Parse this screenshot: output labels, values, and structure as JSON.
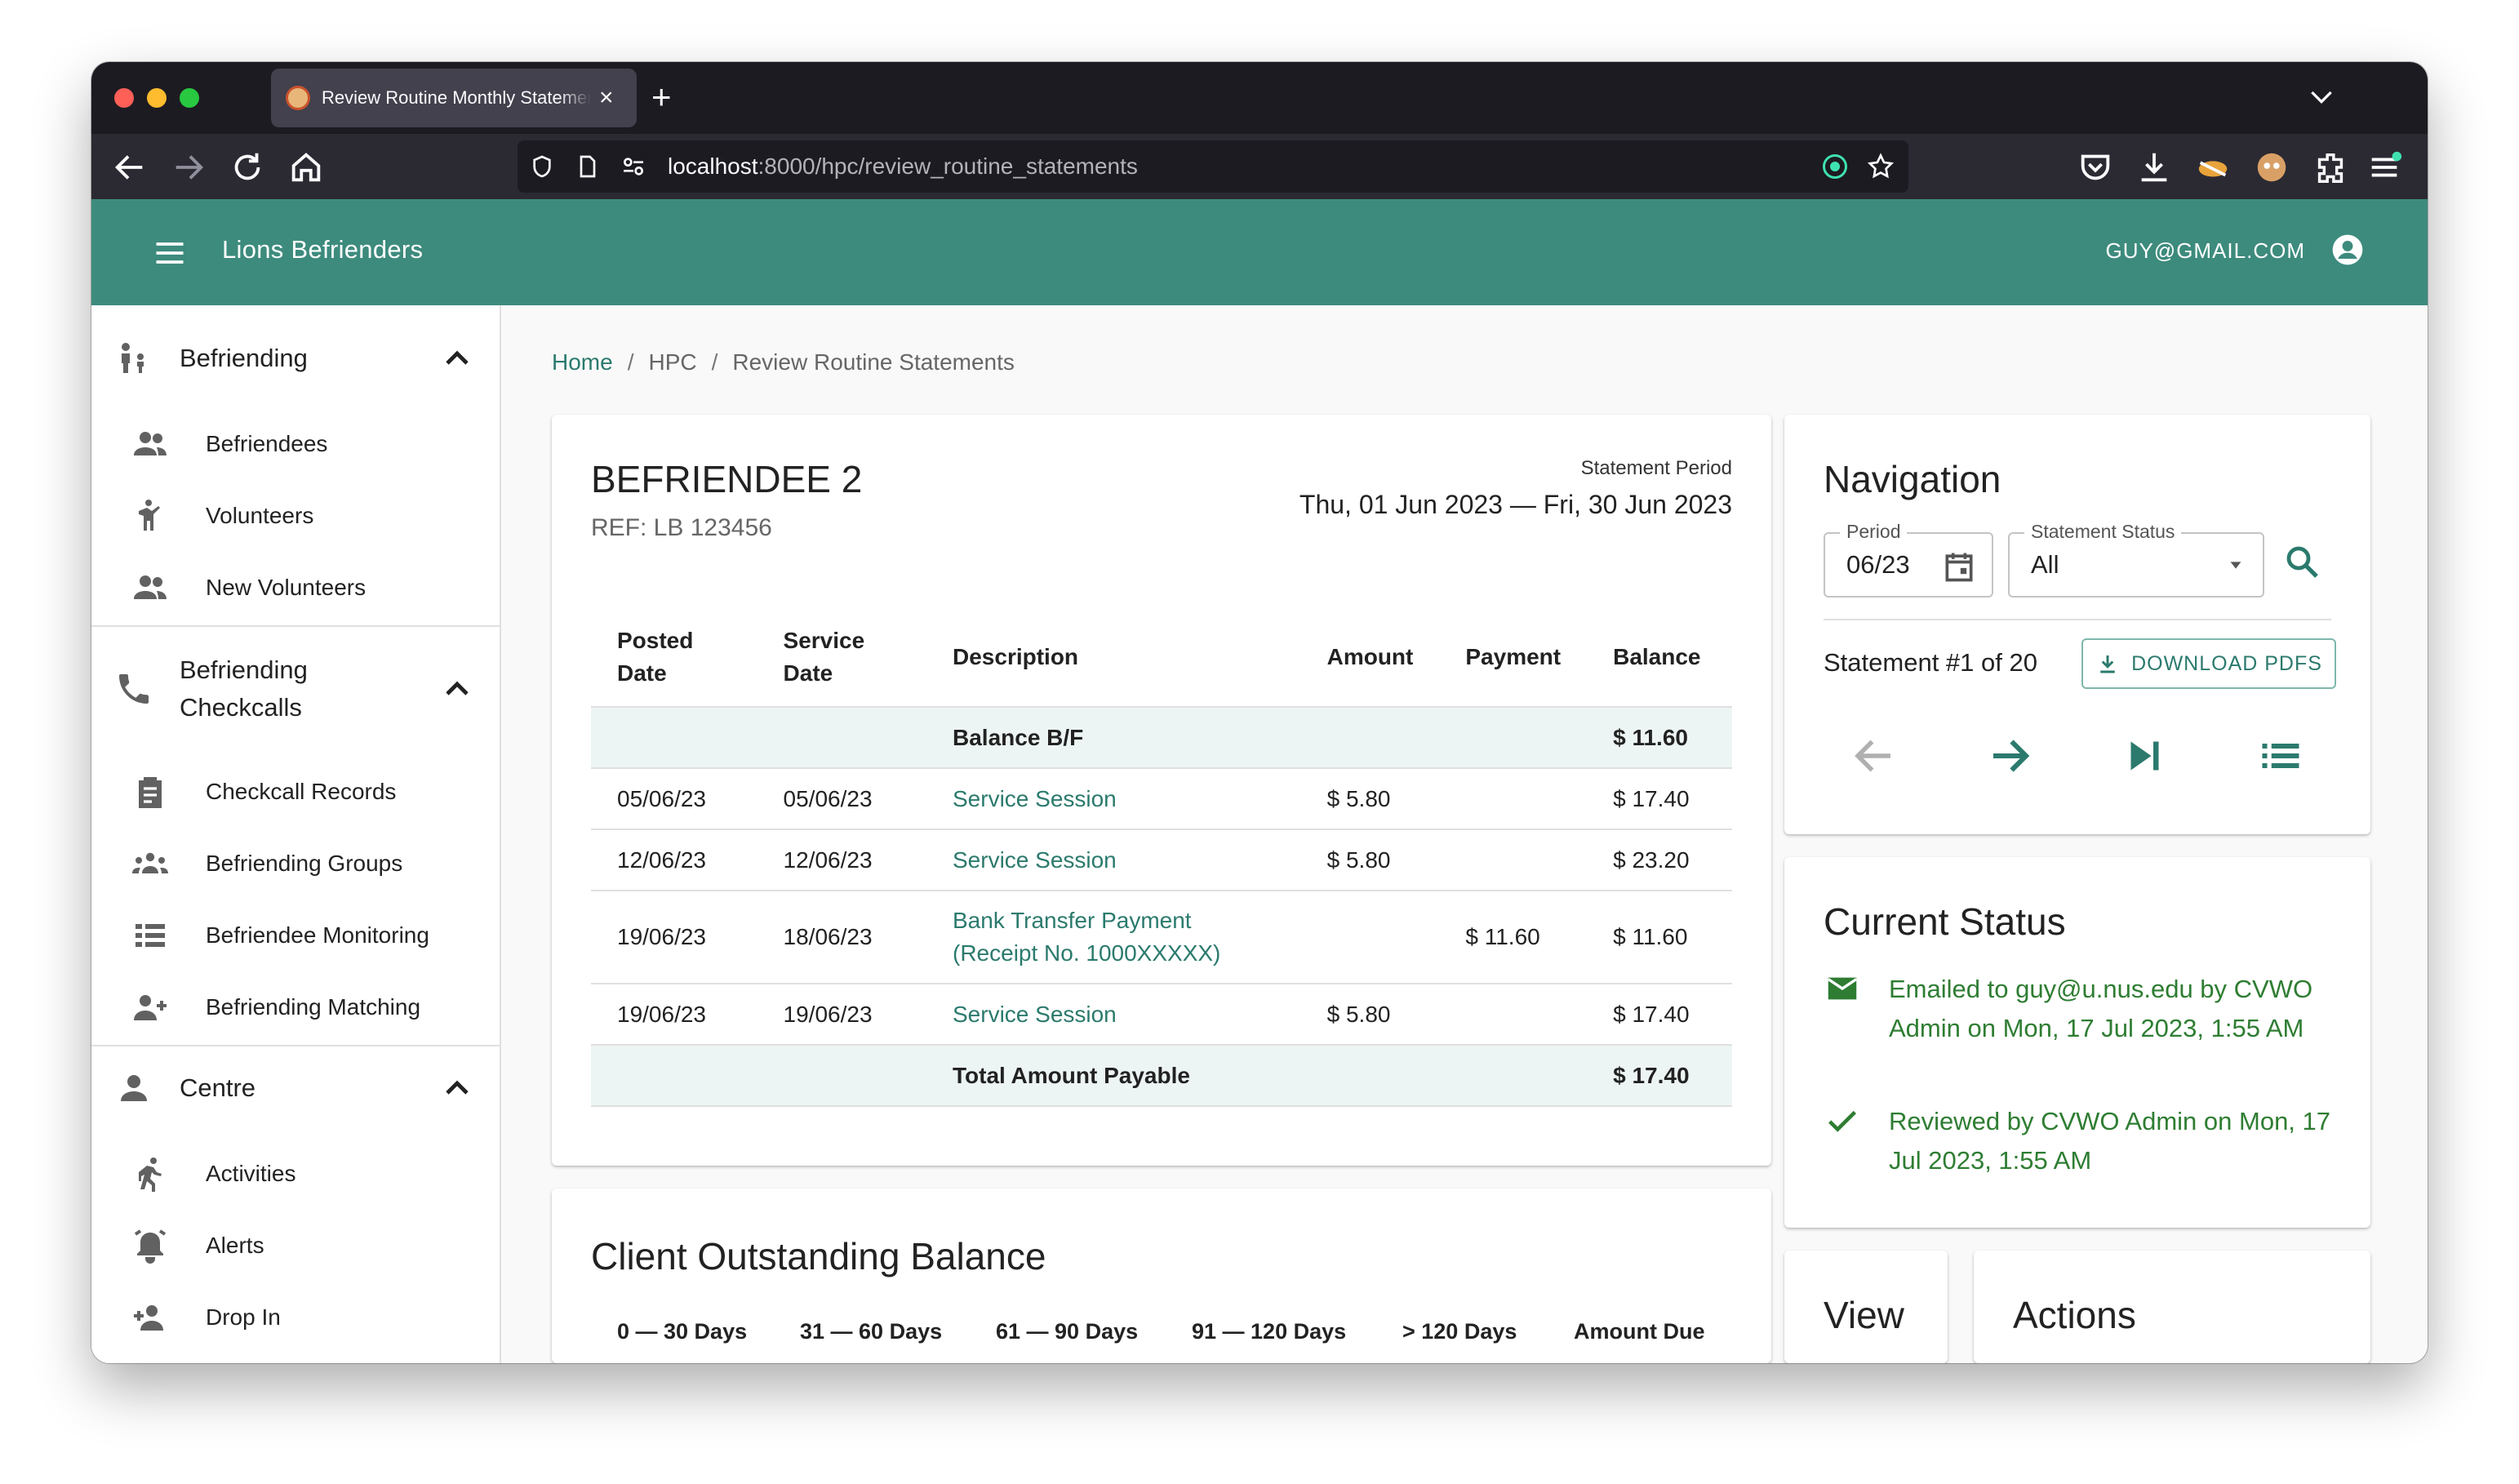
{
  "browser": {
    "tab_title": "Review Routine Monthly Statements",
    "url_host": "localhost",
    "url_path": ":8000/hpc/review_routine_statements"
  },
  "appbar": {
    "title": "Lions Befrienders",
    "user_email": "GUY@GMAIL.COM"
  },
  "sidebar": {
    "groups": [
      {
        "label": "Befriending",
        "icon": "family-icon",
        "items": [
          {
            "label": "Befriendees",
            "icon": "people-icon"
          },
          {
            "label": "Volunteers",
            "icon": "volunteer-icon"
          },
          {
            "label": "New Volunteers",
            "icon": "people-icon"
          }
        ]
      },
      {
        "label": "Befriending Checkcalls",
        "icon": "phone-icon",
        "items": [
          {
            "label": "Checkcall Records",
            "icon": "clipboard-icon"
          },
          {
            "label": "Befriending Groups",
            "icon": "groups-icon"
          },
          {
            "label": "Befriendee Monitoring",
            "icon": "list-icon"
          },
          {
            "label": "Befriending Matching",
            "icon": "person-add-icon"
          }
        ]
      },
      {
        "label": "Centre",
        "icon": "person-icon",
        "items": [
          {
            "label": "Activities",
            "icon": "run-icon"
          },
          {
            "label": "Alerts",
            "icon": "alarm-icon"
          },
          {
            "label": "Drop In",
            "icon": "person-add-icon"
          }
        ]
      }
    ]
  },
  "breadcrumb": {
    "home": "Home",
    "sep": "/",
    "hpc": "HPC",
    "current": "Review Routine Statements"
  },
  "statement": {
    "name": "BEFRIENDEE 2",
    "ref": "REF: LB 123456",
    "period_label": "Statement Period",
    "period_value": "Thu, 01 Jun 2023 — Fri, 30 Jun 2023",
    "headers": {
      "posted_date": "Posted Date",
      "service_date": "Service Date",
      "description": "Description",
      "amount": "Amount",
      "payment": "Payment",
      "balance": "Balance"
    },
    "balance_bf": {
      "description": "Balance B/F",
      "balance": "$ 11.60"
    },
    "rows": [
      {
        "posted": "05/06/23",
        "service": "05/06/23",
        "description": "Service Session",
        "amount": "$ 5.80",
        "payment": "",
        "balance": "$ 17.40"
      },
      {
        "posted": "12/06/23",
        "service": "12/06/23",
        "description": "Service Session",
        "amount": "$ 5.80",
        "payment": "",
        "balance": "$ 23.20"
      },
      {
        "posted": "19/06/23",
        "service": "18/06/23",
        "description": "Bank Transfer Payment (Receipt No. 1000XXXXX)",
        "amount": "",
        "payment": "$ 11.60",
        "balance": "$ 11.60"
      },
      {
        "posted": "19/06/23",
        "service": "19/06/23",
        "description": "Service Session",
        "amount": "$ 5.80",
        "payment": "",
        "balance": "$ 17.40"
      }
    ],
    "total": {
      "description": "Total Amount Payable",
      "balance": "$ 17.40"
    }
  },
  "outstanding": {
    "title": "Client Outstanding Balance",
    "columns": [
      "0 — 30 Days",
      "31 — 60 Days",
      "61 — 90 Days",
      "91 — 120 Days",
      "> 120 Days",
      "Amount Due"
    ]
  },
  "navigation": {
    "title": "Navigation",
    "period_label": "Period",
    "period_value": "06/23",
    "status_label": "Statement Status",
    "status_value": "All",
    "statement_count": "Statement #1 of 20",
    "download_label": "DOWNLOAD PDFS"
  },
  "current_status": {
    "title": "Current Status",
    "emailed": "Emailed to guy@u.nus.edu by CVWO Admin on Mon, 17 Jul 2023, 1:55 AM",
    "reviewed": "Reviewed by CVWO Admin on Mon, 17 Jul 2023, 1:55 AM"
  },
  "view": {
    "title": "View"
  },
  "actions": {
    "title": "Actions"
  },
  "colors": {
    "primary": "#3d8b7d",
    "link": "#2b7a6d",
    "status_green": "#2e7d32",
    "highlight_row": "#edf5f4"
  }
}
